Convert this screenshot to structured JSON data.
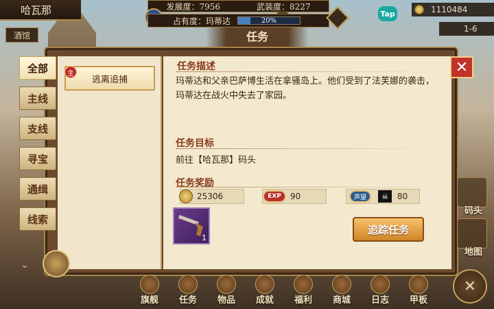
{
  "top": {
    "city": "哈瓦那",
    "development_label": "发展度：",
    "development_value": "7956",
    "armament_label": "武装度：",
    "armament_value": "8227",
    "occupancy_label": "占有度：",
    "occupancy_city": "玛蒂达",
    "occupancy_percent": "20%",
    "occupancy_fraction": 0.2,
    "gold": "1110484",
    "stage": "1-6",
    "tap_badge": "Tap"
  },
  "tavern_tab": "酒馆",
  "window_title": "任务",
  "tabs": [
    "全部",
    "主线",
    "支线",
    "寻宝",
    "通缉",
    "线索"
  ],
  "task_list": [
    {
      "badge": "主",
      "title": "逃离追捕"
    }
  ],
  "detail": {
    "desc_title": "任务描述",
    "desc_text": "玛蒂达和父亲巴萨博生活在拿骚岛上。他们受到了法芙娜的袭击，玛蒂达在战火中失去了家园。",
    "target_title": "任务目标",
    "target_text": "前往【哈瓦那】码头",
    "reward_title": "任务奖励",
    "reward_gold": "25306",
    "reward_exp_icon": "EXP",
    "reward_exp": "90",
    "reward_rep_icon": "声望",
    "reward_rep": "80",
    "item_qty": "1",
    "track_button": "追踪任务"
  },
  "close_icon": "✕",
  "side_buttons": [
    "码头",
    "地图"
  ],
  "bottom_nav": [
    "旗舰",
    "任务",
    "物品",
    "成就",
    "福利",
    "商城",
    "日志",
    "甲板"
  ]
}
